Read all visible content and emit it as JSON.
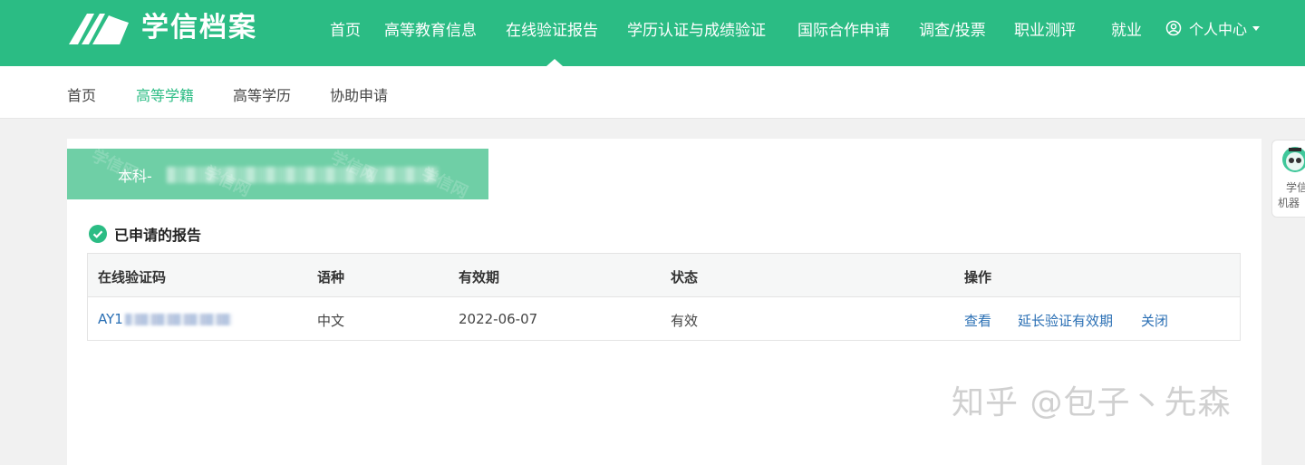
{
  "brand": {
    "name": "学信档案",
    "accent": "#2bbc84",
    "icon": "book-logo-icon"
  },
  "nav": {
    "items": [
      "首页",
      "高等教育信息",
      "在线验证报告",
      "学历认证与成绩验证",
      "国际合作申请",
      "调查/投票",
      "职业测评",
      "就业"
    ],
    "active": "在线验证报告",
    "user_menu": "个人中心"
  },
  "subnav": {
    "items": [
      "首页",
      "高等学籍",
      "高等学历",
      "协助申请"
    ],
    "active": "高等学籍"
  },
  "degree_banner": {
    "label": "本科-"
  },
  "reports": {
    "title": "已申请的报告",
    "columns": [
      "在线验证码",
      "语种",
      "有效期",
      "状态",
      "操作"
    ],
    "rows": [
      {
        "code": "AY1",
        "language": "中文",
        "valid_until": "2022-06-07",
        "status": "有效",
        "actions": [
          "查看",
          "延长验证有效期",
          "关闭"
        ]
      }
    ]
  },
  "robot": {
    "line1": "学信",
    "line2": "机器"
  },
  "watermark": "知乎 @包子丶先森",
  "colors": {
    "link": "#2a6fb4",
    "header_bg": "#2bbc84",
    "banner_bg": "#6fcfa6"
  }
}
